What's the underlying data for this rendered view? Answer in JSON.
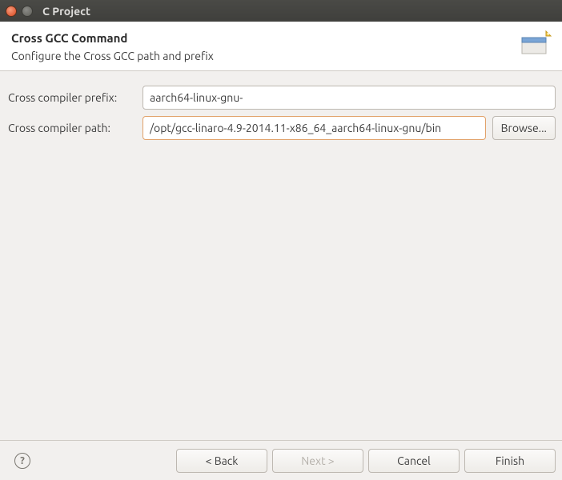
{
  "window": {
    "title": "C Project"
  },
  "header": {
    "title": "Cross GCC Command",
    "subtitle": "Configure the Cross GCC path and prefix"
  },
  "form": {
    "prefix_label": "Cross compiler prefix:",
    "prefix_value": "aarch64-linux-gnu-",
    "path_label": "Cross compiler path:",
    "path_value": "/opt/gcc-linaro-4.9-2014.11-x86_64_aarch64-linux-gnu/bin",
    "browse_label": "Browse..."
  },
  "footer": {
    "help": "?",
    "back": "< Back",
    "next": "Next >",
    "cancel": "Cancel",
    "finish": "Finish"
  }
}
